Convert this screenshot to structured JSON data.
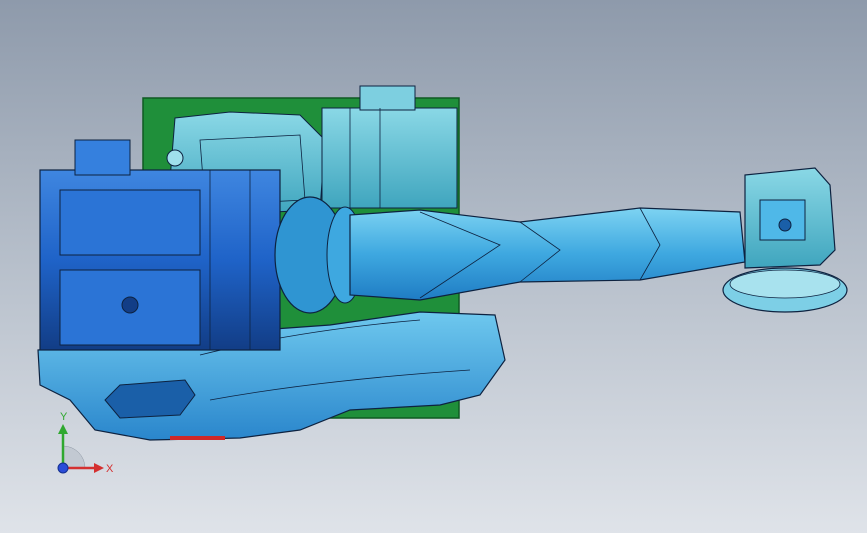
{
  "viewport": {
    "background_top": "#8e9aab",
    "background_bottom": "#dfe3e9"
  },
  "model": {
    "colors": {
      "base_plate": "#1f8f3a",
      "base_plate_edge": "#0f5a22",
      "arm_light": "#4fb8e8",
      "arm_mid": "#2f95d2",
      "arm_dark": "#1a5fa8",
      "motor_blue": "#1f63c8",
      "motor_dark": "#123d86",
      "casting_teal": "#62c2d6",
      "edge_line": "#0d2240",
      "accent_red": "#d02828"
    }
  },
  "triad": {
    "y_label": "Y",
    "x_label": "X",
    "y_color": "#2fa82f",
    "x_color": "#d43030",
    "z_color": "#2a4cd8"
  }
}
